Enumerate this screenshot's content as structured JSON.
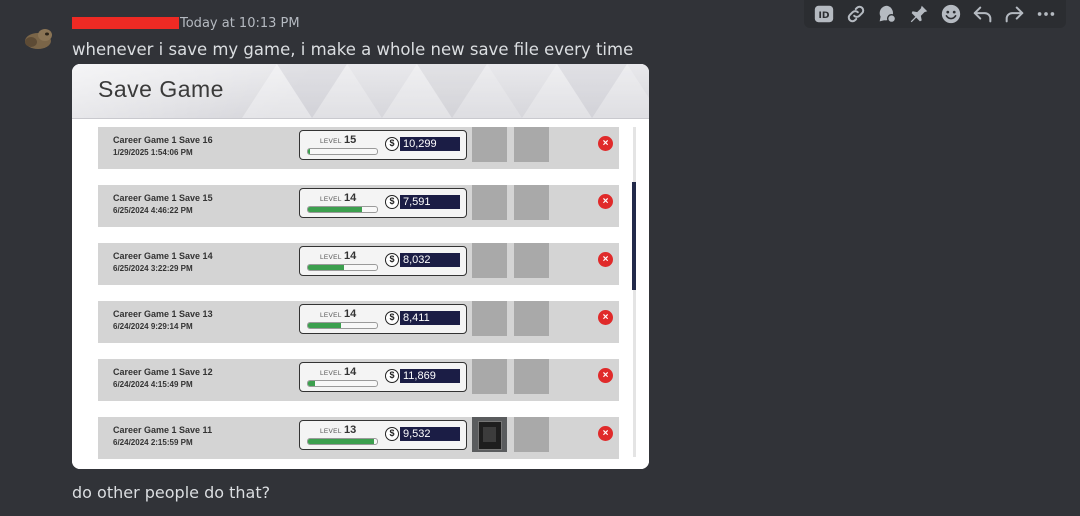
{
  "message": {
    "timestamp": "Today at 10:13 PM",
    "text": "whenever i save my game, i make a whole new save file every time",
    "reply": "do other people do that?"
  },
  "toolbar": {
    "id_label": "ID",
    "icons": [
      "id-icon",
      "link-icon",
      "thread-icon",
      "pin-icon",
      "emoji-icon",
      "reply-icon",
      "forward-icon",
      "more-icon"
    ]
  },
  "save_game": {
    "title": "Save Game",
    "level_label": "LEVEL",
    "currency_symbol": "$",
    "delete_symbol": "×",
    "saves": [
      {
        "name": "Career Game 1 Save 16",
        "date": "1/29/2025 1:54:06 PM",
        "level": "15",
        "money": "10,299",
        "xp_fraction": 0.03,
        "thumb_image": false
      },
      {
        "name": "Career Game 1 Save 15",
        "date": "6/25/2024 4:46:22 PM",
        "level": "14",
        "money": "7,591",
        "xp_fraction": 0.78,
        "thumb_image": false
      },
      {
        "name": "Career Game 1 Save 14",
        "date": "6/25/2024 3:22:29 PM",
        "level": "14",
        "money": "8,032",
        "xp_fraction": 0.52,
        "thumb_image": false
      },
      {
        "name": "Career Game 1 Save 13",
        "date": "6/24/2024 9:29:14 PM",
        "level": "14",
        "money": "8,411",
        "xp_fraction": 0.48,
        "thumb_image": false
      },
      {
        "name": "Career Game 1 Save 12",
        "date": "6/24/2024 4:15:49 PM",
        "level": "14",
        "money": "11,869",
        "xp_fraction": 0.1,
        "thumb_image": false
      },
      {
        "name": "Career Game 1 Save 11",
        "date": "6/24/2024 2:15:59 PM",
        "level": "13",
        "money": "9,532",
        "xp_fraction": 0.96,
        "thumb_image": true
      }
    ]
  },
  "colors": {
    "background": "#313338",
    "redaction": "#ee2a24",
    "xp_green": "#3c9f4e",
    "money_bg": "#1b1d45",
    "delete_red": "#e02a2a"
  }
}
